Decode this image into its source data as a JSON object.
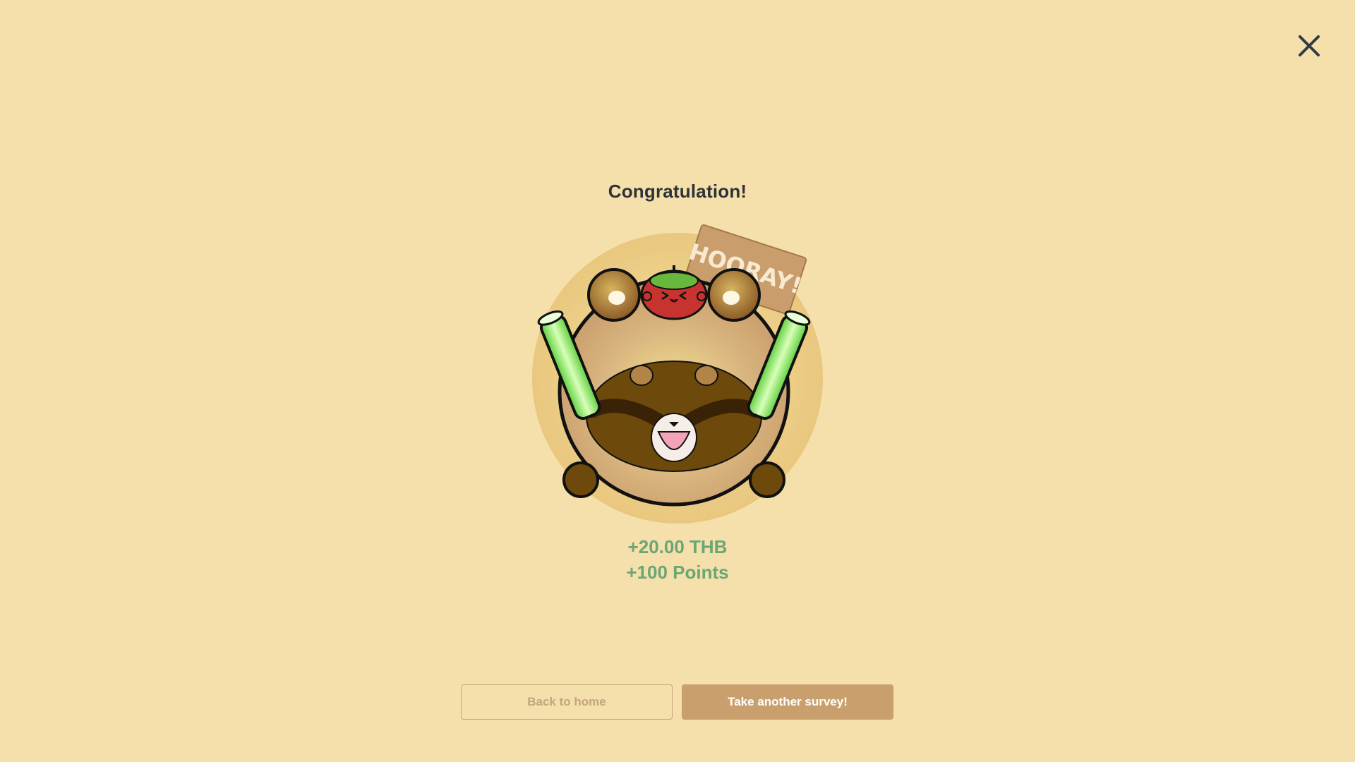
{
  "dialog": {
    "title": "Congratulation!",
    "sign_text": "HOORAY!",
    "close_icon": "close-icon"
  },
  "rewards": {
    "money": "+20.00 THB",
    "points": "+100 Points"
  },
  "actions": {
    "back_label": "Back to home",
    "survey_label": "Take another survey!"
  },
  "colors": {
    "background": "#f5dfaa",
    "accent": "#c9a06d",
    "reward_text": "#6aa775",
    "title_text": "#2e3338"
  }
}
